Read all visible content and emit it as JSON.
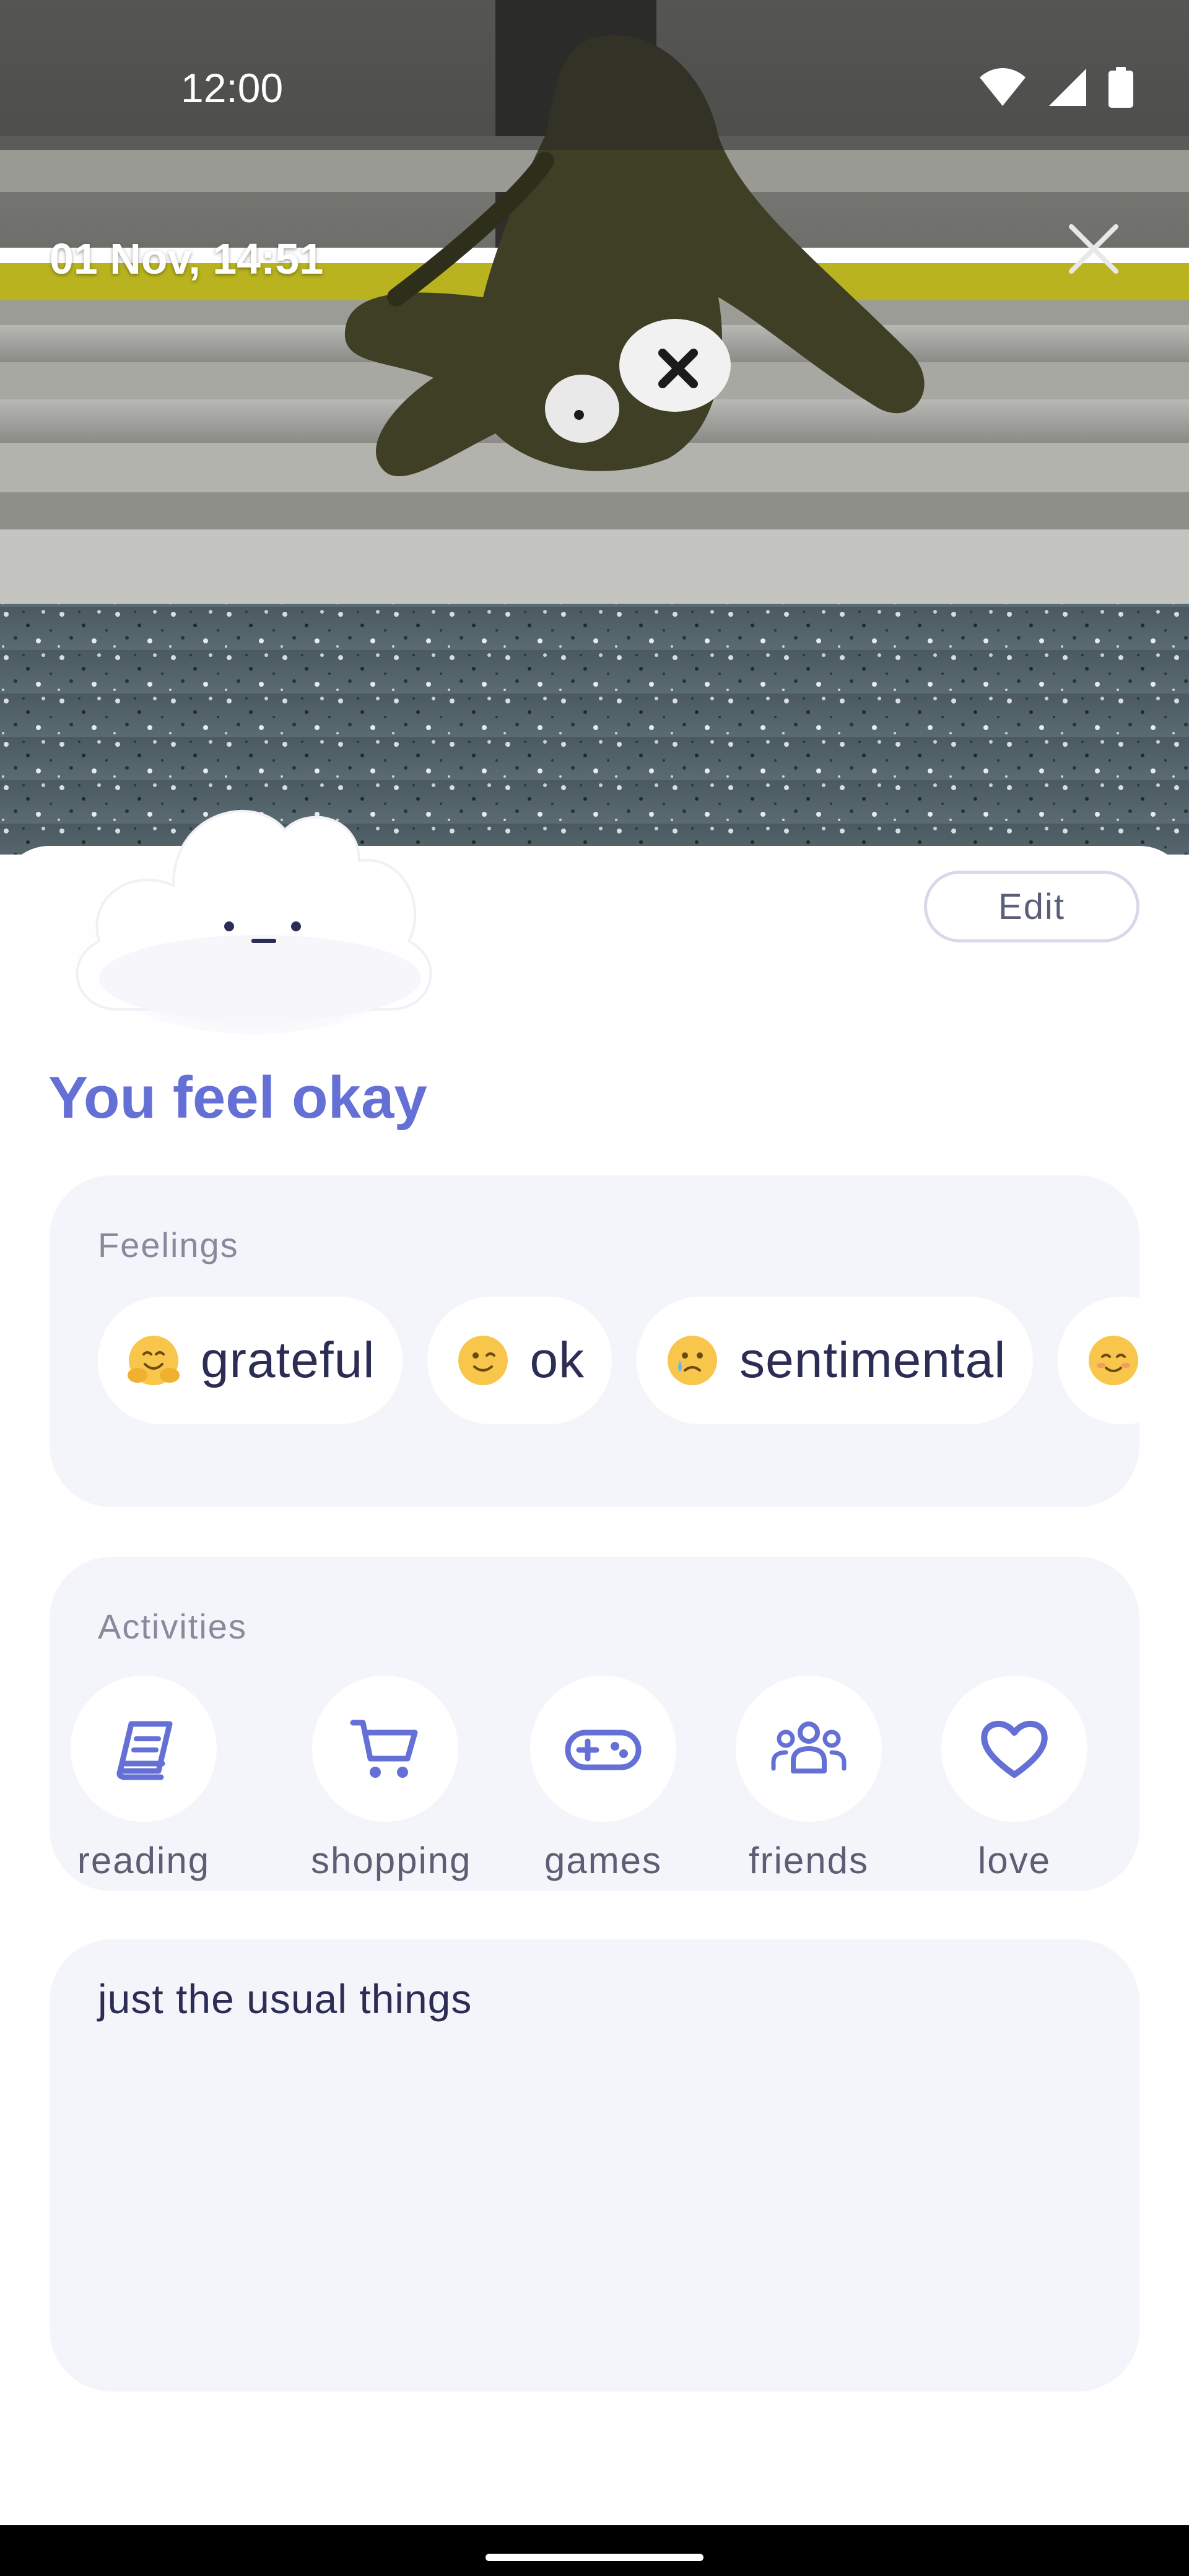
{
  "status_bar": {
    "time": "12:00",
    "icons": [
      "wifi-icon",
      "signal-icon",
      "battery-icon"
    ]
  },
  "entry": {
    "datetime": "01 Nov, 14:51",
    "close_icon": "close-icon",
    "edit_label": "Edit",
    "mood_icon": "neutral-cloud-icon",
    "mood_title": "You feel okay",
    "note": "just the usual things"
  },
  "feelings": {
    "title": "Feelings",
    "items": [
      {
        "emoji": "hugging-face-icon",
        "label": "grateful"
      },
      {
        "emoji": "winking-face-icon",
        "label": "ok"
      },
      {
        "emoji": "crying-face-icon",
        "label": "sentimental"
      },
      {
        "emoji": "smiling-face-icon",
        "label": ""
      }
    ]
  },
  "activities": {
    "title": "Activities",
    "items": [
      {
        "icon": "book-icon",
        "label": "reading"
      },
      {
        "icon": "cart-icon",
        "label": "shopping"
      },
      {
        "icon": "gamepad-icon",
        "label": "games"
      },
      {
        "icon": "people-icon",
        "label": "friends"
      },
      {
        "icon": "heart-icon",
        "label": "love"
      }
    ]
  },
  "colors": {
    "accent": "#6470d6",
    "card_bg": "#f4f5fb",
    "text_dark": "#2b2d55",
    "text_muted": "#888a9c"
  }
}
